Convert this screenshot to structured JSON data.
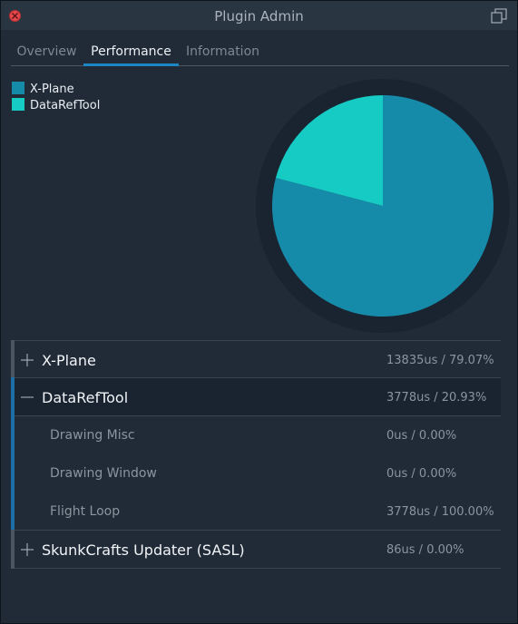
{
  "window": {
    "title": "Plugin Admin",
    "close_icon": "close-icon",
    "popout_icon": "popout-window-icon"
  },
  "tabs": [
    {
      "label": "Overview",
      "active": false
    },
    {
      "label": "Performance",
      "active": true
    },
    {
      "label": "Information",
      "active": false
    }
  ],
  "legend": [
    {
      "label": "X-Plane",
      "color": "#168aa9"
    },
    {
      "label": "DataRefTool",
      "color": "#15cbc4"
    }
  ],
  "chart_data": {
    "type": "pie",
    "labels": [
      "X-Plane",
      "DataRefTool"
    ],
    "values": [
      79.07,
      20.93
    ],
    "colors": [
      "#168aa9",
      "#15cbc4"
    ]
  },
  "rows": [
    {
      "name": "X-Plane",
      "value": "13835us / 79.07%",
      "kind": "parent",
      "expanded": false
    },
    {
      "name": "DataRefTool",
      "value": "3778us / 20.93%",
      "kind": "parent",
      "expanded": true
    },
    {
      "name": "Drawing Misc",
      "value": "0us / 0.00%",
      "kind": "child"
    },
    {
      "name": "Drawing Window",
      "value": "0us / 0.00%",
      "kind": "child"
    },
    {
      "name": "Flight Loop",
      "value": "3778us / 100.00%",
      "kind": "child"
    },
    {
      "name": "SkunkCrafts Updater (SASL)",
      "value": "86us / 0.00%",
      "kind": "parent",
      "expanded": false
    }
  ]
}
